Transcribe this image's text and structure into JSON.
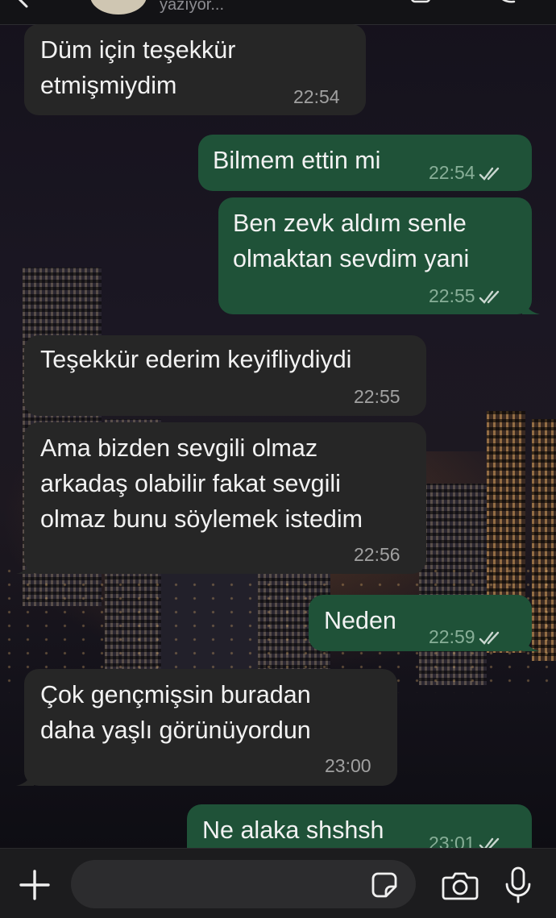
{
  "header": {
    "status": "yazıyor..."
  },
  "messages": [
    {
      "direction": "in",
      "text": "Düm için teşekkür\netmişmiydim",
      "time": "22:54"
    },
    {
      "direction": "out",
      "text": "Bilmem ettin mi",
      "time": "22:54",
      "read": true
    },
    {
      "direction": "out",
      "text": "Ben zevk aldım senle\nolmaktan sevdim yani",
      "time": "22:55",
      "read": true
    },
    {
      "direction": "in",
      "text": "Teşekkür ederim keyifliydiydi",
      "time": "22:55"
    },
    {
      "direction": "in",
      "text": "Ama bizden sevgili olmaz\narkadaş olabilir fakat sevgili\nolmaz bunu söylemek istedim",
      "time": "22:56"
    },
    {
      "direction": "out",
      "text": "Neden",
      "time": "22:59",
      "read": true
    },
    {
      "direction": "in",
      "text": "Çok gençmişsin buradan\ndaha yaşlı görünüyordun",
      "time": "23:00"
    },
    {
      "direction": "out",
      "text": "Ne alaka shshsh",
      "time": "23:01",
      "read": true
    }
  ],
  "composer": {
    "placeholder": "",
    "value": ""
  },
  "colors": {
    "incoming_bubble": "#262626",
    "outgoing_bubble": "#1f5238",
    "read_ticks": "#c9d6cf"
  },
  "icons": {
    "header_left": "back-chevron-icon",
    "header_right": [
      "video-call-icon",
      "phone-call-icon"
    ],
    "composer": [
      "plus-icon",
      "sticker-icon",
      "camera-icon",
      "microphone-icon"
    ]
  }
}
